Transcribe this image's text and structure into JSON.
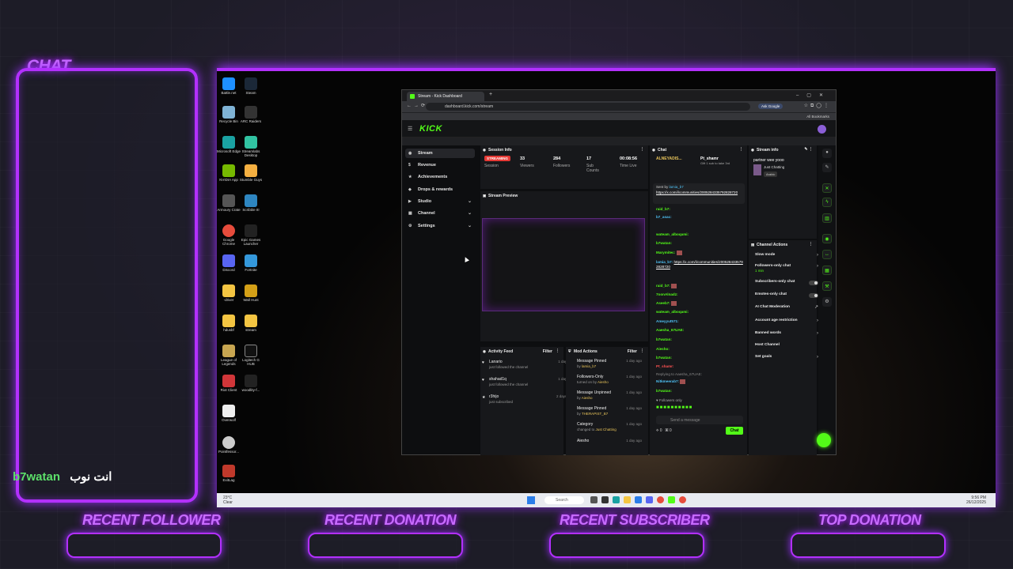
{
  "overlay": {
    "chat_title": "CHAT",
    "chat_message": {
      "user": "b7watan",
      "text": "انت نوب"
    },
    "labels": {
      "recent_follower": "RECENT FOLLOWER",
      "recent_donation": "RECENT DONATION",
      "recent_subscriber": "RECENT SUBSCRIBER",
      "top_donation": "TOP DONATION"
    }
  },
  "desktop": {
    "icons": [
      "Battle.net",
      "Steam",
      "Recycle Bin",
      "ARC Raiders",
      "Microsoft Edge",
      "Streamlabs Desktop",
      "NVIDIA App",
      "Stumble Guys",
      "Armoury Crate",
      "Scribble It!",
      "Google Chrome",
      "Epic Games Launcher",
      "Discord",
      "Fortnite",
      "-driver",
      "Wall Hunt",
      "hdusbf",
      "stream",
      "League of Legends",
      "Logitech G HUB",
      "Riot Client",
      "woodlity-f...",
      "Overwolf",
      "Pointfessor...",
      "ExitLag"
    ],
    "taskbar": {
      "weather_temp": "23°C",
      "weather_desc": "Clear",
      "search": "Search",
      "time": "9:56 PM",
      "date": "26/12/2025"
    }
  },
  "browser": {
    "tab_title": "Stream - Kick Dashboard",
    "url": "dashboard.kick.com/stream",
    "ask_google": "Ask Google",
    "all_bookmarks": "All Bookmarks"
  },
  "kick": {
    "logo": "KICK",
    "nav": [
      {
        "label": "Stream",
        "icon": "◉"
      },
      {
        "label": "Revenue",
        "icon": "$"
      },
      {
        "label": "Achievements",
        "icon": "★"
      },
      {
        "label": "Drops & rewards",
        "icon": "◆"
      },
      {
        "label": "Studio",
        "icon": "▶"
      },
      {
        "label": "Channel",
        "icon": "▦"
      },
      {
        "label": "Settings",
        "icon": "⚙"
      }
    ],
    "session": {
      "title": "Session Info",
      "status": "STREAMING",
      "status_label": "Session",
      "viewers": "33",
      "viewers_label": "Viewers",
      "followers": "284",
      "followers_label": "Followers",
      "subs": "17",
      "subs_label": "Sub Counts",
      "time": "00:08:56",
      "time_label": "Time Live"
    },
    "preview_title": "Stream Preview",
    "activity": {
      "title": "Activity Feed",
      "filter": "Filter",
      "items": [
        {
          "name": "Lanario",
          "sub": "just followed the channel",
          "when": "1 day ago"
        },
        {
          "name": "shahad1q",
          "sub": "just followed the channel",
          "when": "1 day ago"
        },
        {
          "name": "r3hijo",
          "sub": "just subscribed",
          "when": "2 days ago"
        }
      ]
    },
    "mod": {
      "title": "Mod Actions",
      "filter": "Filter",
      "items": [
        {
          "name": "Message Pinned",
          "by": "by",
          "who": "lamia_b7",
          "when": "1 day ago"
        },
        {
          "name": "Followers-Only",
          "by": "turned on by",
          "who": "Aiesho",
          "when": "1 day ago"
        },
        {
          "name": "Message Unpinned",
          "by": "by",
          "who": "Aiesho",
          "when": "1 day ago"
        },
        {
          "name": "Message Pinned",
          "by": "by",
          "who": "THERAPIST_B7",
          "when": "1 day ago"
        },
        {
          "name": "Category",
          "by": "changed to",
          "who": "Just Chatting",
          "when": "1 day ago"
        },
        {
          "name": "Aiesho",
          "by": "",
          "who": "",
          "when": "1 day ago"
        }
      ]
    },
    "chat": {
      "title": "Chat",
      "top_user": "ALNEYADIS...",
      "top_user2": "Pt_shamr",
      "gift": "Gift 1 sub to take 3rd",
      "sent_by": "Sent by",
      "sent_by_user": "lamia_b7",
      "pinned_link": "https://x.com/i/communities/2005284335792828720",
      "lines": [
        {
          "user": "raid_b7:",
          "text": ""
        },
        {
          "user": "b7_asac:",
          "text": ""
        },
        {
          "user": "wateam_alboqami:",
          "text": ""
        },
        {
          "user": "b7watan:",
          "text": ""
        },
        {
          "user": "Marymitec:",
          "text": ""
        },
        {
          "user": "lamia_b7:",
          "text": "https://x.com/i/communities/2005284335792828720"
        },
        {
          "user": "raid_b7:",
          "text": ""
        },
        {
          "user": "7oonAlnadz:",
          "text": ""
        },
        {
          "user": "Aseeb7:",
          "text": ""
        },
        {
          "user": "wateam_alboqami:",
          "text": ""
        },
        {
          "user": "Ameyyut571:",
          "text": ""
        },
        {
          "user": "Aaesha_67UAE:",
          "text": ""
        },
        {
          "user": "b7watan:",
          "text": ""
        },
        {
          "user": "Aiesho:",
          "text": ""
        },
        {
          "user": "b7watan:",
          "text": ""
        },
        {
          "user": "Pt_shamr:",
          "text": ""
        },
        {
          "user": "Replying to Aaesha_67UAE:",
          "text": ""
        },
        {
          "user": "Nitkmeerab7:",
          "text": ""
        },
        {
          "user": "b7watan:",
          "text": ""
        }
      ],
      "followers_only": "Followers only",
      "send_placeholder": "Send a message",
      "count1": "0",
      "count2": "0",
      "send_button": "Chat"
    },
    "stream_info": {
      "title": "Stream info",
      "stream_title": "partner wee yooo",
      "category": "Just Chatting",
      "language": "Arabic"
    },
    "channel_actions": {
      "title": "Channel Actions",
      "items": [
        {
          "label": "Slow mode",
          "sub": ""
        },
        {
          "label": "Followers-only chat",
          "sub": "1 min"
        },
        {
          "label": "Subscribers-only chat",
          "sub": ""
        },
        {
          "label": "Emotes-only chat",
          "sub": ""
        },
        {
          "label": "AI Chat Moderation",
          "sub": ""
        },
        {
          "label": "Account age restriction",
          "sub": ""
        },
        {
          "label": "Banned words",
          "sub": ""
        },
        {
          "label": "Host Channel",
          "sub": ""
        },
        {
          "label": "Set goals",
          "sub": ""
        }
      ]
    }
  }
}
